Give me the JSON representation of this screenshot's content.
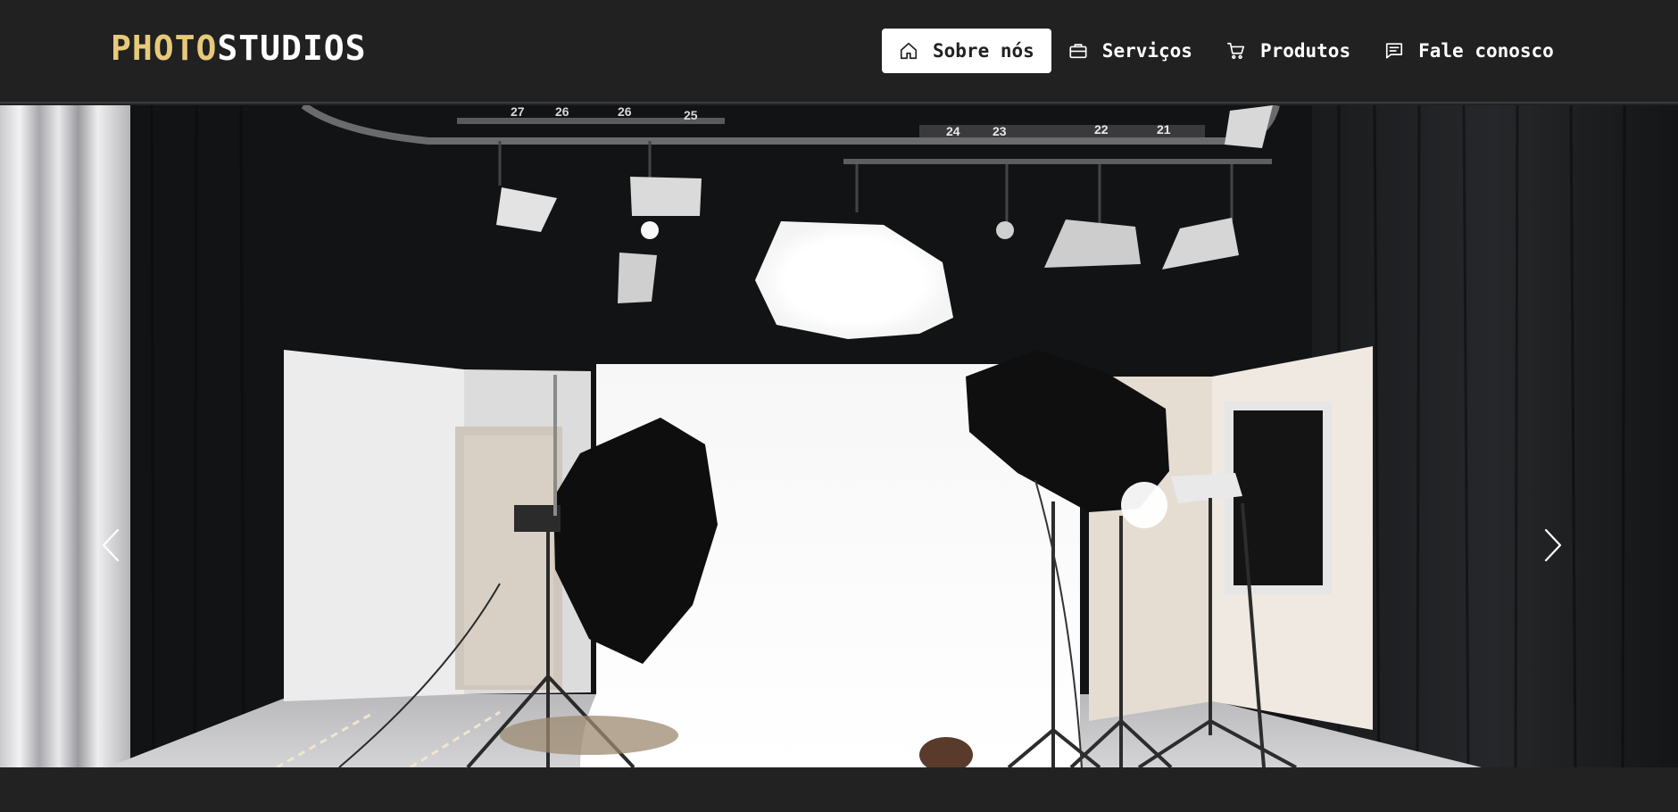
{
  "brand": {
    "part1": "PHOTO",
    "part2": "STUDIOS"
  },
  "nav": {
    "items": [
      {
        "label": "Sobre nós",
        "icon": "home-icon",
        "active": true
      },
      {
        "label": "Serviços",
        "icon": "briefcase-icon",
        "active": false
      },
      {
        "label": "Produtos",
        "icon": "cart-icon",
        "active": false
      },
      {
        "label": "Fale conosco",
        "icon": "chat-icon",
        "active": false
      }
    ]
  },
  "carousel": {
    "slide_count": 3,
    "active_slide": 1,
    "ceiling_rail_numbers": [
      "27",
      "26",
      "26",
      "25",
      "24",
      "23",
      "22",
      "21"
    ]
  },
  "colors": {
    "navbar_bg": "#212121",
    "brand_accent": "#e8c97a",
    "active_nav_bg": "#ffffff",
    "page_bg": "#222222"
  }
}
